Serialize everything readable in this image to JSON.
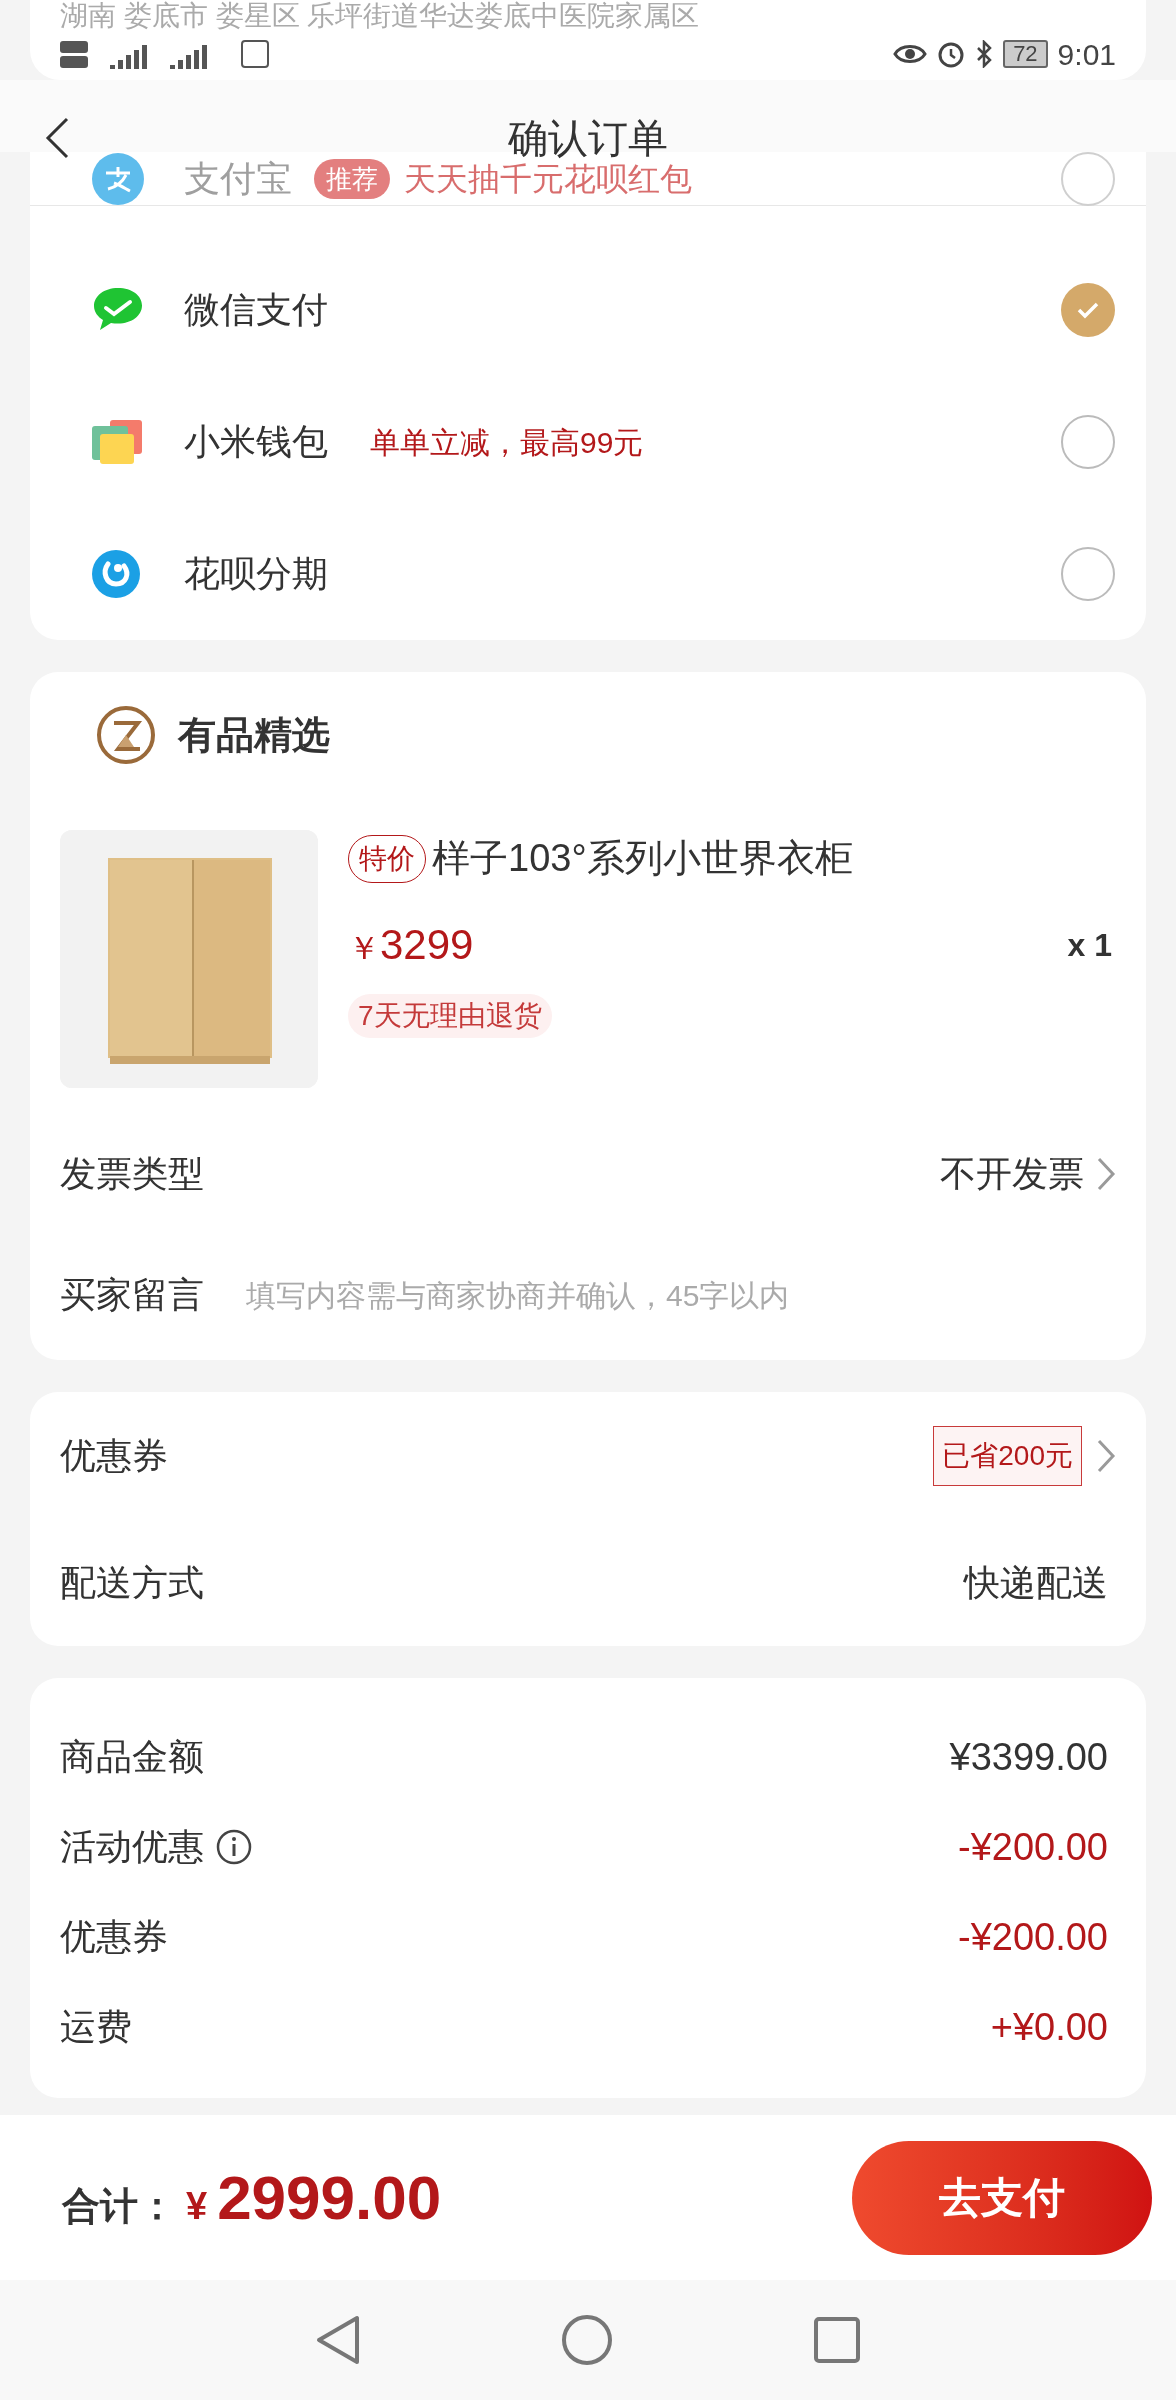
{
  "status_bar": {
    "address": "湖南 娄底市 娄星区 乐坪街道华达娄底中医院家属区",
    "battery": "72",
    "time": "9:01"
  },
  "header": {
    "title": "确认订单"
  },
  "payment_methods": [
    {
      "kind": "alipay",
      "name": "支付宝",
      "badge": "推荐",
      "promo": "天天抽千元花呗红包",
      "selected": false
    },
    {
      "kind": "wechat",
      "name": "微信支付",
      "selected": true
    },
    {
      "kind": "xiaomi",
      "name": "小米钱包",
      "promo": "单单立减，最高99元",
      "selected": false
    },
    {
      "kind": "huabei",
      "name": "花呗分期",
      "selected": false
    }
  ],
  "store": {
    "name": "有品精选"
  },
  "product": {
    "tag": "特价",
    "title": "样子103°系列小世界衣柜",
    "currency": "￥",
    "price": "3299",
    "quantity": "x 1",
    "service": "7天无理由退货"
  },
  "invoice": {
    "label": "发票类型",
    "value": "不开发票"
  },
  "message": {
    "label": "买家留言",
    "placeholder": "填写内容需与商家协商并确认，45字以内"
  },
  "coupon": {
    "label": "优惠券",
    "value": "已省200元"
  },
  "delivery": {
    "label": "配送方式",
    "value": "快递配送"
  },
  "summary": [
    {
      "kind": "base",
      "label": "商品金额",
      "value": "¥3399.00",
      "info": false
    },
    {
      "kind": "adjust",
      "label": "活动优惠",
      "value": "-¥200.00",
      "info": true
    },
    {
      "kind": "adjust",
      "label": "优惠券",
      "value": "-¥200.00",
      "info": false
    },
    {
      "kind": "adjust",
      "label": "运费",
      "value": "+¥0.00",
      "info": false
    }
  ],
  "total": {
    "label": "合计：",
    "currency": "¥",
    "amount": "2999.00"
  },
  "pay_button": "去支付"
}
